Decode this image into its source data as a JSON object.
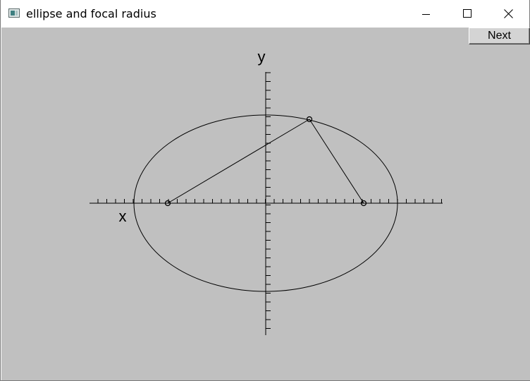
{
  "window": {
    "title": "ellipse and focal radius",
    "controls": [
      "minimize",
      "maximize",
      "close"
    ]
  },
  "toolbar": {
    "next_label": "Next"
  },
  "axes": {
    "x_label": "x",
    "y_label": "y"
  },
  "colors": {
    "canvas_background": "#c0c0c0",
    "stroke": "#000000"
  }
}
